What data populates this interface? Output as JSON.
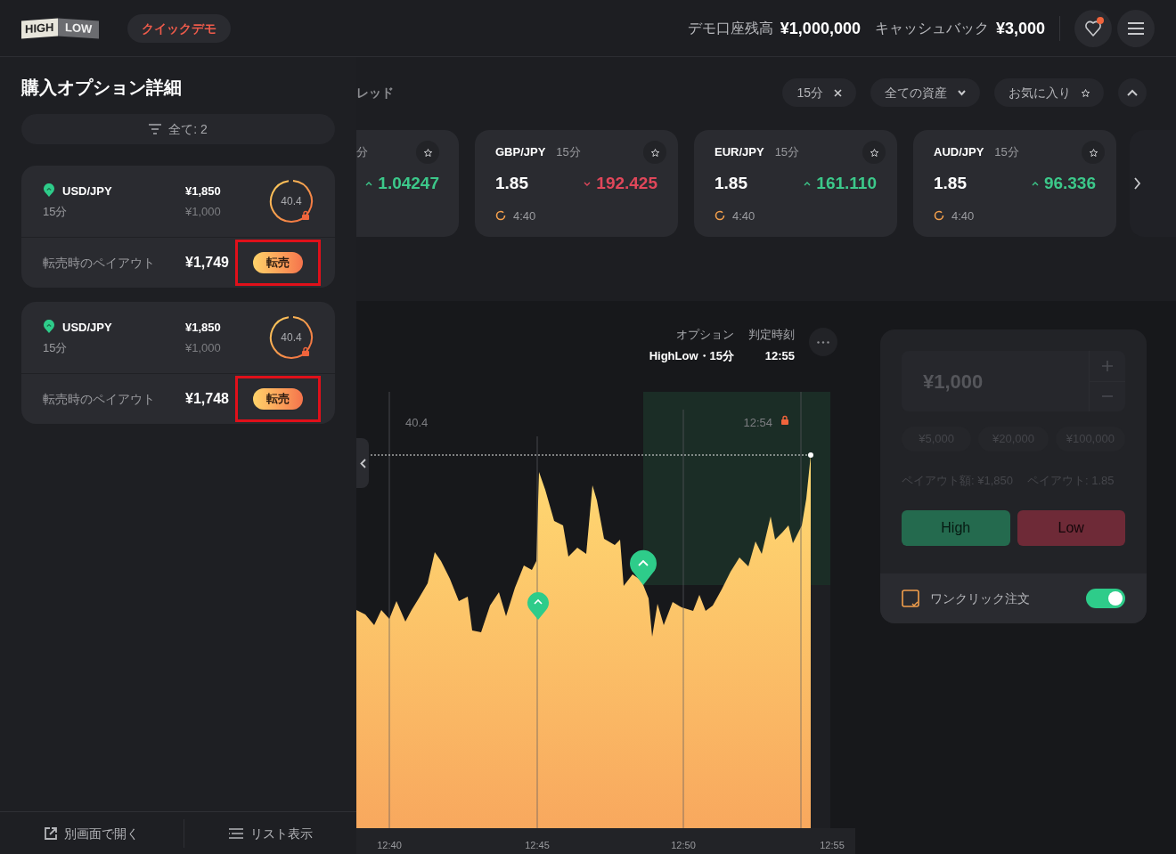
{
  "header": {
    "logo": {
      "left": "HIGH",
      "right": "LOW"
    },
    "demo_badge": "クイックデモ",
    "balance_label": "デモ口座残高",
    "balance": "¥1,000,000",
    "cashback_label": "キャッシュバック",
    "cashback": "¥3,000",
    "notification_dot": true
  },
  "side_panel": {
    "title": "購入オプション詳細",
    "filter": "全て: 2",
    "positions": [
      {
        "pair": "USD/JPY",
        "duration": "15分",
        "payout": "¥1,850",
        "stake": "¥1,000",
        "strike": "40.4",
        "resale_label": "転売時のペイアウト",
        "resale_value": "¥1,749",
        "resale_button": "転売",
        "highlighted": true
      },
      {
        "pair": "USD/JPY",
        "duration": "15分",
        "payout": "¥1,850",
        "stake": "¥1,000",
        "strike": "40.4",
        "resale_label": "転売時のペイアウト",
        "resale_value": "¥1,748",
        "resale_button": "転売",
        "highlighted": true
      }
    ],
    "footer": [
      "別画面で開く",
      "リスト表示"
    ]
  },
  "assets": {
    "section_title": "レッド",
    "filters": [
      {
        "kind": "clear",
        "label": "15分"
      },
      {
        "kind": "dropdown",
        "label": "全ての資産"
      },
      {
        "kind": "favorite",
        "label": "お気に入り"
      }
    ],
    "cards": [
      {
        "kind": "partial",
        "duration": "分",
        "rising": true,
        "price": "1.04247"
      },
      {
        "kind": "full",
        "pair": "GBP/JPY",
        "duration": "15分",
        "payout": "1.85",
        "rising": false,
        "price": "192.425",
        "timer": "4:40"
      },
      {
        "kind": "full",
        "pair": "EUR/JPY",
        "duration": "15分",
        "payout": "1.85",
        "rising": true,
        "price": "161.110",
        "timer": "4:40"
      },
      {
        "kind": "full",
        "pair": "AUD/JPY",
        "duration": "15分",
        "payout": "1.85",
        "rising": true,
        "price": "96.336",
        "timer": "4:40"
      }
    ]
  },
  "chart": {
    "option_label": "オプション",
    "option_value": "HighLow・15分",
    "expiry_label": "判定時刻",
    "expiry_value": "12:55",
    "strike_label": "40.4",
    "lock_time": "12:54",
    "x_ticks": [
      "12:40",
      "12:45",
      "12:50",
      "12:55"
    ]
  },
  "trade": {
    "amount": "¥1,000",
    "presets": [
      "¥5,000",
      "¥20,000",
      "¥100,000"
    ],
    "payout_amount": "ペイアウト額: ¥1,850",
    "payout_rate": "ペイアウト: 1.85",
    "disabled": true,
    "high": "High",
    "low": "Low",
    "one_click_label": "ワンクリック注文",
    "one_click_on": true
  }
}
